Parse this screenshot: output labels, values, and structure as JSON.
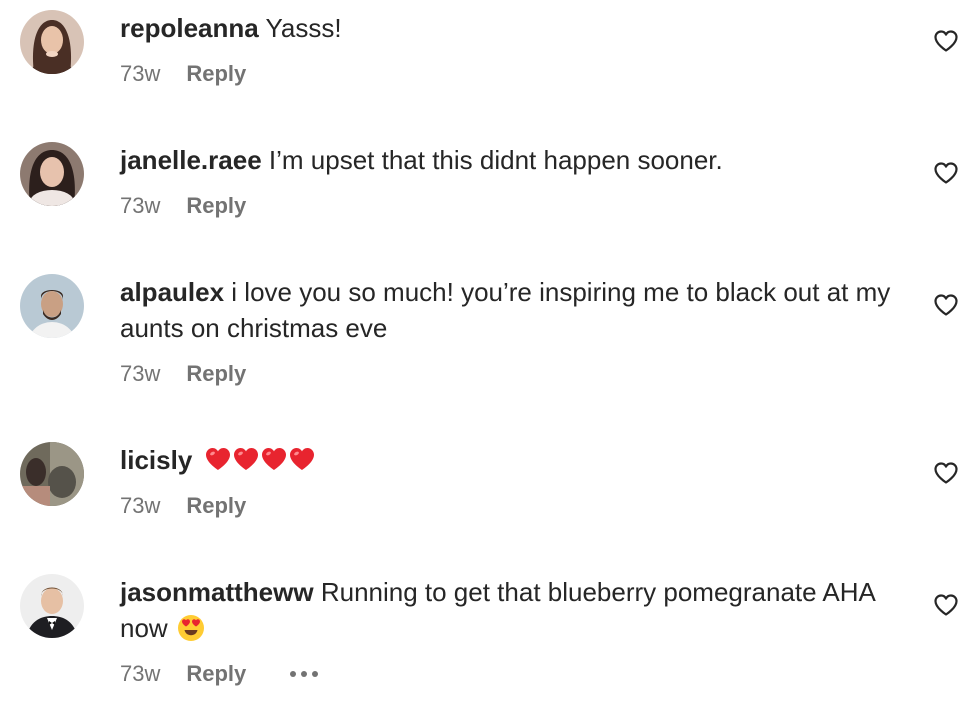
{
  "comments": [
    {
      "username": "repoleanna",
      "text": "Yasss!",
      "time": "73w",
      "reply": "Reply",
      "avatar_icon": "avatar-photo",
      "like_icon": "heart-outline-icon"
    },
    {
      "username": "janelle.raee",
      "text": "I’m upset that this didnt happen sooner.",
      "time": "73w",
      "reply": "Reply",
      "avatar_icon": "avatar-photo",
      "like_icon": "heart-outline-icon"
    },
    {
      "username": "alpaulex",
      "text": "i love you so much! you’re inspiring me to black out at my aunts on christmas eve",
      "time": "73w",
      "reply": "Reply",
      "avatar_icon": "avatar-photo",
      "like_icon": "heart-outline-icon"
    },
    {
      "username": "licisly",
      "text": "",
      "emoji": "red-heart-emoji x4",
      "time": "73w",
      "reply": "Reply",
      "avatar_icon": "avatar-photo",
      "like_icon": "heart-outline-icon"
    },
    {
      "username": "jasonmattheww",
      "text": "Running to get that blueberry pomegranate AHA now",
      "emoji": "heart-eyes-emoji",
      "time": "73w",
      "reply": "Reply",
      "more_icon": "more-options-icon",
      "avatar_icon": "avatar-photo",
      "like_icon": "heart-outline-icon"
    }
  ],
  "colors": {
    "primary_text": "#262626",
    "secondary_text": "#737373",
    "heart_red": "#e0245e"
  }
}
